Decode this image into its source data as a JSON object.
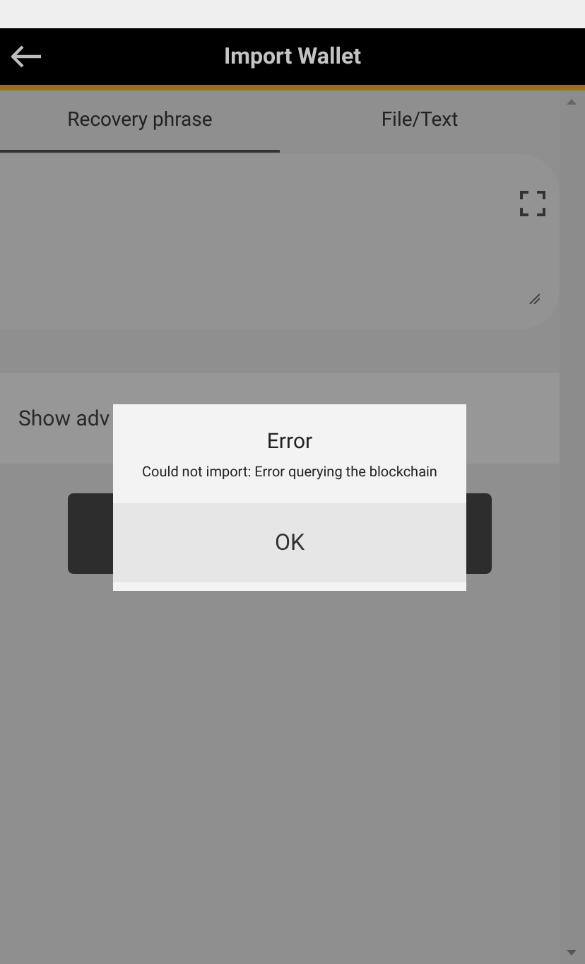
{
  "header": {
    "title": "Import Wallet"
  },
  "tabs": [
    {
      "label": "Recovery phrase",
      "selected": true
    },
    {
      "label": "File/Text",
      "selected": false
    }
  ],
  "advanced": {
    "label": "Show adv"
  },
  "dialog": {
    "title": "Error",
    "message": "Could not import: Error querying the blockchain",
    "button": "OK"
  }
}
